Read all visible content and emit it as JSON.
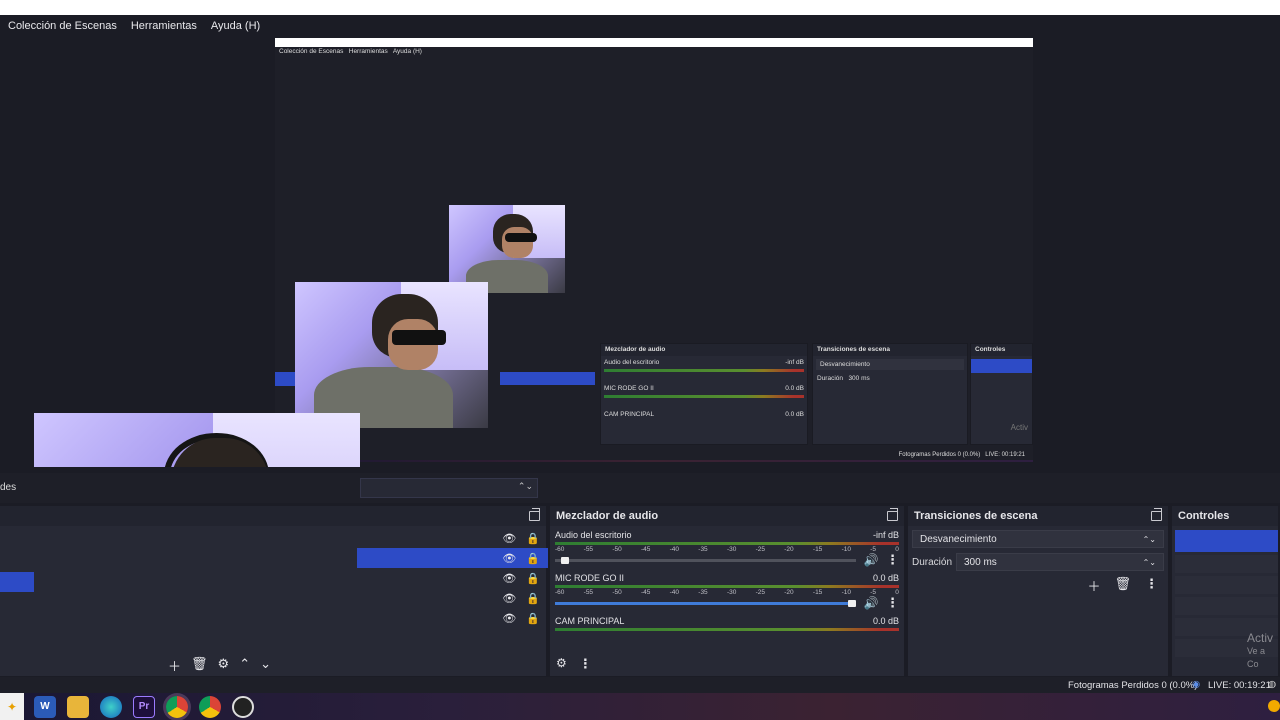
{
  "menu": [
    "Colección de Escenas",
    "Herramientas",
    "Ayuda (H)"
  ],
  "nested_menu": [
    "Colección de Escenas",
    "Herramientas",
    "Ayuda (H)"
  ],
  "scenes_partial_label": "des",
  "mid": {
    "audio_title": "Mezclador de audio",
    "transitions_title": "Transiciones de escena",
    "controls_title": "Controles",
    "desktop": "Audio del escritorio",
    "desktop_db": "-inf dB",
    "mic": "MIC RODE GO II",
    "mic_db": "0.0 dB",
    "cam": "CAM PRINCIPAL",
    "cam_db": "0.0 dB",
    "transition": "Desvanecimiento",
    "duration_label": "Duración",
    "duration_value": "300 ms",
    "status": "Fotogramas Perdidos 0 (0.0%)",
    "live": "LIVE: 00:19:21",
    "watermark": "Activ"
  },
  "audio_mixer": {
    "title": "Mezclador de audio",
    "ticks": [
      "-60",
      "-55",
      "-50",
      "-45",
      "-40",
      "-35",
      "-30",
      "-25",
      "-20",
      "-15",
      "-10",
      "-5",
      "0"
    ],
    "channels": [
      {
        "name": "Audio del escritorio",
        "db": "-inf dB",
        "volume": 0.02
      },
      {
        "name": "MIC RODE GO II",
        "db": "0.0 dB",
        "volume": 1.0
      },
      {
        "name": "CAM PRINCIPAL",
        "db": "0.0 dB",
        "volume": 1.0
      }
    ]
  },
  "transitions": {
    "title": "Transiciones de escena",
    "selected": "Desvanecimiento",
    "duration_label": "Duración",
    "duration_value": "300 ms"
  },
  "controls": {
    "title": "Controles",
    "watermark_1": "Activ",
    "watermark_2": "Ve a Co"
  },
  "status": {
    "dropped": "Fotogramas Perdidos 0 (0.0%)",
    "live": "LIVE: 00:19:21"
  },
  "taskbar": {
    "icons": [
      "start-icon",
      "word-icon",
      "file-explorer-icon",
      "edge-icon",
      "premiere-icon",
      "chrome-icon",
      "chrome-alt-icon",
      "obs-icon"
    ],
    "premiere_label": "Pr",
    "word_label": "W"
  },
  "colors": {
    "accent": "#2d4bc6",
    "panel": "#272935",
    "background": "#1b1c25"
  }
}
